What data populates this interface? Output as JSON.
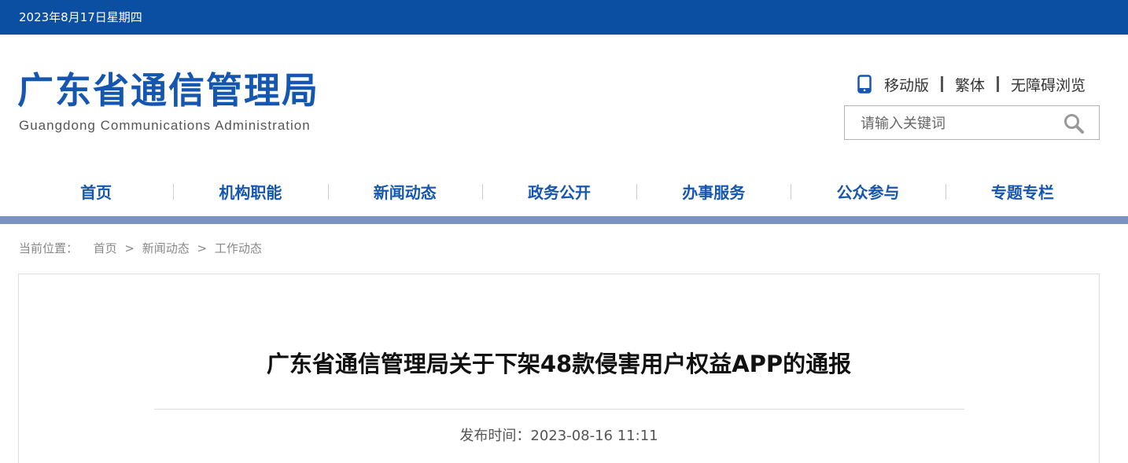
{
  "topbar": {
    "date": "2023年8月17日星期四"
  },
  "header": {
    "logo_cn": "广东省通信管理局",
    "logo_en": "Guangdong Communications Administration",
    "links": {
      "mobile": "移动版",
      "traditional": "繁体",
      "accessible": "无障碍浏览"
    },
    "search": {
      "placeholder": "请输入关键词"
    }
  },
  "nav": {
    "items": [
      {
        "label": "首页"
      },
      {
        "label": "机构职能"
      },
      {
        "label": "新闻动态"
      },
      {
        "label": "政务公开"
      },
      {
        "label": "办事服务"
      },
      {
        "label": "公众参与"
      },
      {
        "label": "专题专栏"
      }
    ]
  },
  "breadcrumb": {
    "prefix": "当前位置：",
    "items": [
      {
        "label": "首页"
      },
      {
        "label": "新闻动态"
      },
      {
        "label": "工作动态"
      }
    ],
    "sep": ">"
  },
  "article": {
    "title": "广东省通信管理局关于下架48款侵害用户权益APP的通报",
    "publish_label": "发布时间：",
    "publish_time": "2023-08-16 11:11"
  },
  "colors": {
    "topbar": "#0b4fa3",
    "brand_blue": "#1556b0",
    "nav_line": "#7a93bf"
  },
  "icons": {
    "mobile": "phone-icon",
    "search": "search-icon"
  }
}
